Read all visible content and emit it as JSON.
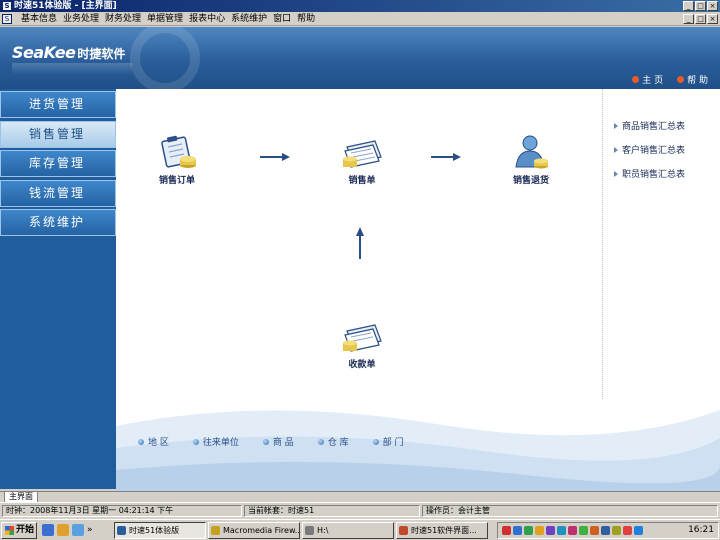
{
  "window": {
    "title": "时速51体验版 - [主界面]",
    "controls": [
      "_",
      "□",
      "×"
    ],
    "menu_controls": [
      "_",
      "□",
      "×"
    ]
  },
  "menu": {
    "items": [
      "基本信息",
      "业务处理",
      "财务处理",
      "单据管理",
      "报表中心",
      "系统维护",
      "窗口",
      "帮助"
    ]
  },
  "banner": {
    "logo_en": "SeaKee",
    "logo_cn": "时捷软件",
    "links": [
      {
        "label": "主  页",
        "icon": "home-icon"
      },
      {
        "label": "帮  助",
        "icon": "help-icon"
      }
    ]
  },
  "sidebar": {
    "items": [
      {
        "label": "进货管理",
        "active": false
      },
      {
        "label": "销售管理",
        "active": true
      },
      {
        "label": "库存管理",
        "active": false
      },
      {
        "label": "钱流管理",
        "active": false
      },
      {
        "label": "系统维护",
        "active": false
      }
    ]
  },
  "flow": {
    "sales_order": "销售订单",
    "sales_slip": "销售单",
    "sales_return": "销售退货",
    "receipt": "收款单"
  },
  "reports": {
    "items": [
      "商品销售汇总表",
      "客户销售汇总表",
      "职员销售汇总表"
    ]
  },
  "bottom_links": [
    "地 区",
    "往来单位",
    "商 品",
    "仓 库",
    "部 门"
  ],
  "tabs": [
    "主界面"
  ],
  "status": {
    "time": "时钟：2008年11月3日 星期一 04:21:14 下午",
    "account": "当前帐套：时速51",
    "operator": "操作员：会计主管"
  },
  "taskbar": {
    "start": "开始",
    "overflow": "»",
    "tasks": [
      "时速51体验版",
      "Macromedia Firew...",
      "H:\\",
      "时速51软件界面..."
    ],
    "clock": "16:21"
  },
  "colors": {
    "banner": "#2a5e9a",
    "sidebar": "#1f5d9d",
    "accent_active": "#a9cbe9",
    "text_dark": "#1a2a55"
  }
}
